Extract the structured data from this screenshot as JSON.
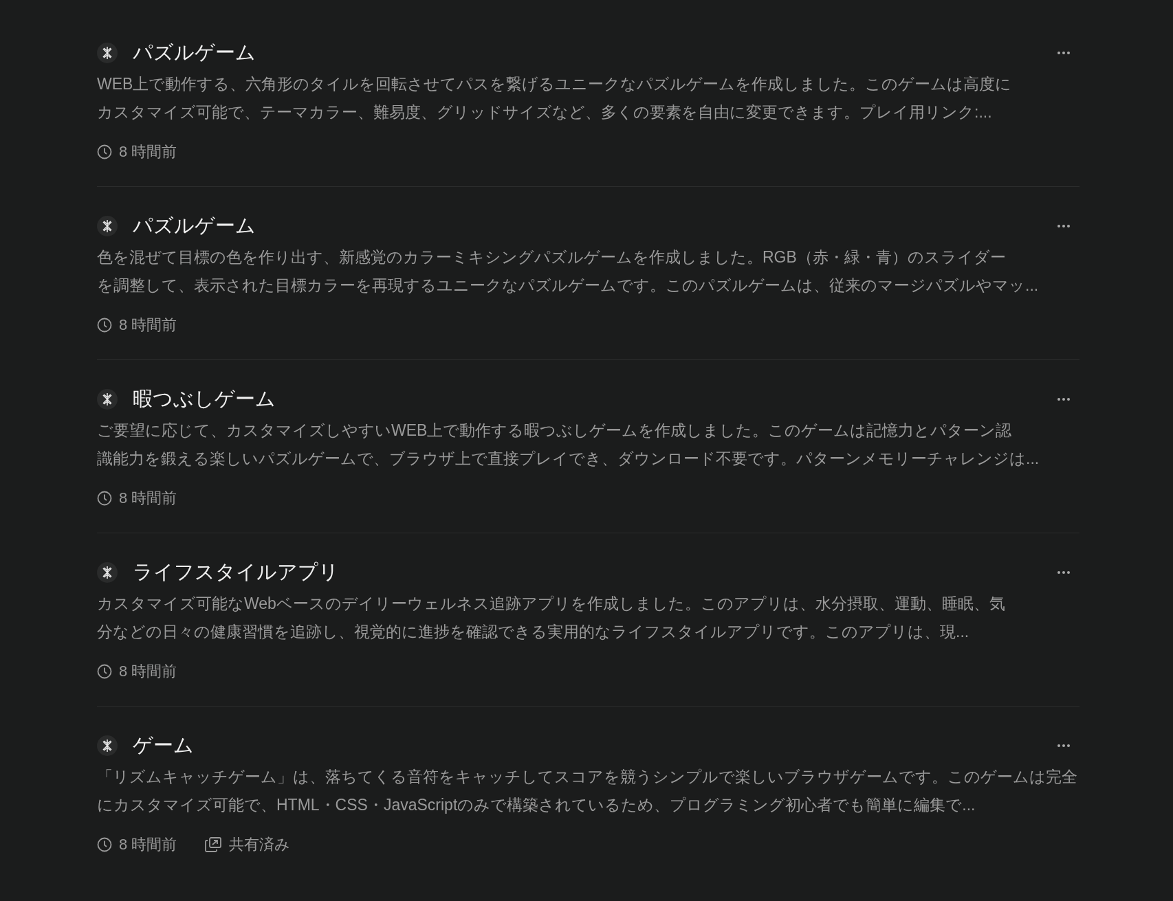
{
  "items": [
    {
      "title": "パズルゲーム",
      "description": [
        "WEB上で動作する、六角形のタイルを回転させてパスを繋げるユニークなパズルゲームを作成しました。このゲームは高度に",
        "カスタマイズ可能で、テーマカラー、難易度、グリッドサイズなど、多くの要素を自由に変更できます。プレイ用リンク:..."
      ],
      "time": "8 時間前"
    },
    {
      "title": "パズルゲーム",
      "description": [
        "色を混ぜて目標の色を作り出す、新感覚のカラーミキシングパズルゲームを作成しました。RGB（赤・緑・青）のスライダー",
        "を調整して、表示された目標カラーを再現するユニークなパズルゲームです。このパズルゲームは、従来のマージパズルやマッ..."
      ],
      "time": "8 時間前"
    },
    {
      "title": "暇つぶしゲーム",
      "description": [
        "ご要望に応じて、カスタマイズしやすいWEB上で動作する暇つぶしゲームを作成しました。このゲームは記憶力とパターン認",
        "識能力を鍛える楽しいパズルゲームで、ブラウザ上で直接プレイでき、ダウンロード不要です。パターンメモリーチャレンジは..."
      ],
      "time": "8 時間前"
    },
    {
      "title": "ライフスタイルアプリ",
      "description": [
        "カスタマイズ可能なWebベースのデイリーウェルネス追跡アプリを作成しました。このアプリは、水分摂取、運動、睡眠、気",
        "分などの日々の健康習慣を追跡し、視覚的に進捗を確認できる実用的なライフスタイルアプリです。このアプリは、現..."
      ],
      "time": "8 時間前"
    },
    {
      "title": "ゲーム",
      "description": [
        "「リズムキャッチゲーム」は、落ちてくる音符をキャッチしてスコアを競うシンプルで楽しいブラウザゲームです。このゲームは完全",
        "にカスタマイズ可能で、HTML・CSS・JavaScriptのみで構築されているため、プログラミング初心者でも簡単に編集で..."
      ],
      "time": "8 時間前",
      "shared": "共有済み"
    }
  ]
}
